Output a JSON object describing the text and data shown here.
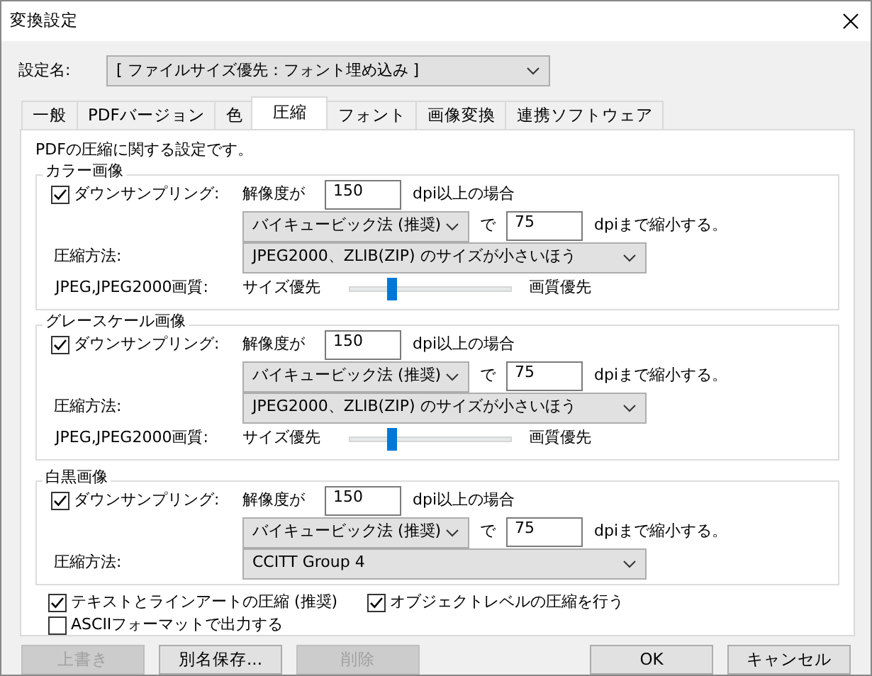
{
  "window": {
    "title": "変換設定"
  },
  "preset": {
    "label": "設定名:",
    "value": "[ ファイルサイズ優先：フォント埋め込み ]"
  },
  "tabs": [
    {
      "label": "一般",
      "selected": false
    },
    {
      "label": "PDFバージョン",
      "selected": false
    },
    {
      "label": "色",
      "selected": false
    },
    {
      "label": "圧縮",
      "selected": true
    },
    {
      "label": "フォント",
      "selected": false
    },
    {
      "label": "画像変換",
      "selected": false
    },
    {
      "label": "連携ソフトウェア",
      "selected": false
    }
  ],
  "description": "PDFの圧縮に関する設定です。",
  "groups": [
    {
      "title": "カラー画像",
      "downsampling": {
        "label": "ダウンサンプリング:",
        "checked": true
      },
      "resolution_label": "解像度が",
      "resolution": "150",
      "resolution_suffix": "dpi以上の場合",
      "method": "バイキュービック法 (推奨)",
      "to_label": "で",
      "target": "75",
      "target_suffix": "dpiまで縮小する。",
      "compression_label": "圧縮方法:",
      "compression": "JPEG2000、ZLIB(ZIP) のサイズが小さいほう",
      "quality": {
        "label": "JPEG,JPEG2000画質:",
        "min_label": "サイズ優先",
        "max_label": "画質優先",
        "level": 0.25
      }
    },
    {
      "title": "グレースケール画像",
      "downsampling": {
        "label": "ダウンサンプリング:",
        "checked": true
      },
      "resolution_label": "解像度が",
      "resolution": "150",
      "resolution_suffix": "dpi以上の場合",
      "method": "バイキュービック法 (推奨)",
      "to_label": "で",
      "target": "75",
      "target_suffix": "dpiまで縮小する。",
      "compression_label": "圧縮方法:",
      "compression": "JPEG2000、ZLIB(ZIP) のサイズが小さいほう",
      "quality": {
        "label": "JPEG,JPEG2000画質:",
        "min_label": "サイズ優先",
        "max_label": "画質優先",
        "level": 0.25
      }
    },
    {
      "title": "白黒画像",
      "downsampling": {
        "label": "ダウンサンプリング:",
        "checked": true
      },
      "resolution_label": "解像度が",
      "resolution": "150",
      "resolution_suffix": "dpi以上の場合",
      "method": "バイキュービック法 (推奨)",
      "to_label": "で",
      "target": "75",
      "target_suffix": "dpiまで縮小する。",
      "compression_label": "圧縮方法:",
      "compression": "CCITT Group 4"
    }
  ],
  "options": [
    {
      "label": "テキストとラインアートの圧縮 (推奨)",
      "checked": true
    },
    {
      "label": "オブジェクトレベルの圧縮を行う",
      "checked": true
    },
    {
      "label": "ASCIIフォーマットで出力する",
      "checked": false
    }
  ],
  "buttons": [
    {
      "label": "上書き",
      "disabled": true
    },
    {
      "label": "別名保存...",
      "disabled": false
    },
    {
      "label": "削除",
      "disabled": true
    },
    {
      "label": "OK",
      "disabled": false
    },
    {
      "label": "キャンセル",
      "disabled": false
    }
  ]
}
